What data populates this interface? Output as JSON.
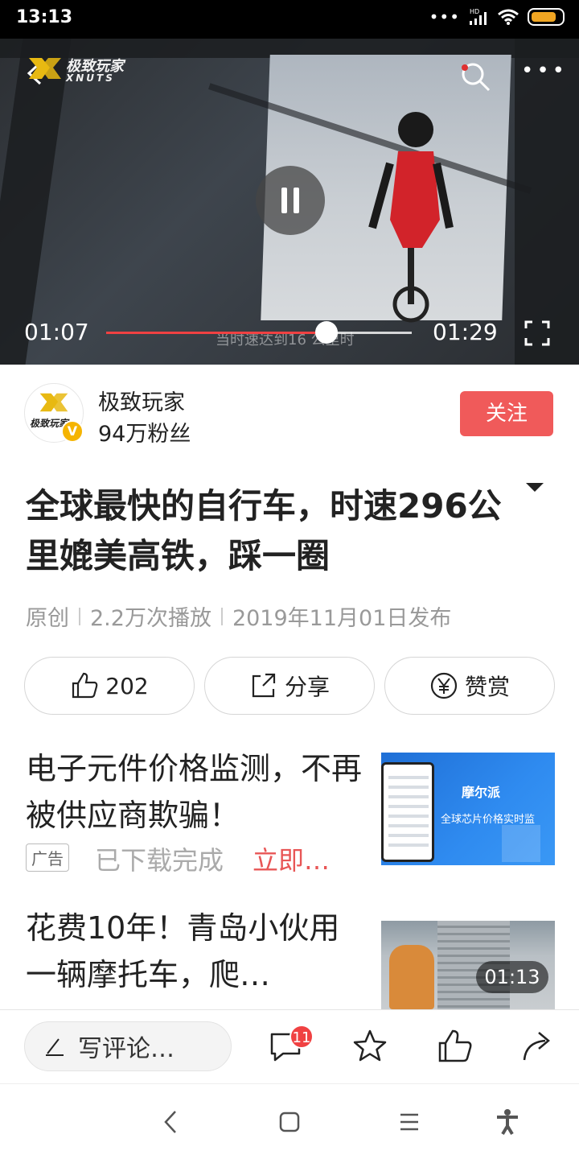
{
  "status_bar": {
    "time": "13:13",
    "network": "HD"
  },
  "video": {
    "brand_name": "极致玩家",
    "brand_sub": "XNUTS",
    "current_time": "01:07",
    "duration": "01:29",
    "progress": 0.72,
    "subtitle": "当时速达到16 公里时"
  },
  "author": {
    "avatar_text": "极致玩家",
    "name": "极致玩家",
    "fans": "94万粉丝",
    "follow_label": "关注",
    "verified_badge": "V"
  },
  "article": {
    "title": "全球最快的自行车，时速296公里媲美高铁，踩一圈",
    "meta": [
      "原创",
      "2.2万次播放",
      "2019年11月01日发布"
    ]
  },
  "actions": {
    "like_count": "202",
    "share_label": "分享",
    "reward_label": "赞赏"
  },
  "feed": [
    {
      "title": "电子元件价格监测，不再被供应商欺骗！",
      "ad_tag": "广告",
      "status": "已下载完成",
      "cta": "立即…",
      "thumb_brand": "摩尔派",
      "thumb_slogan": "全球芯片价格实时监"
    },
    {
      "title": "花费10年！青岛小伙用一辆摩托车，爬…",
      "duration": "01:13"
    }
  ],
  "bottom_bar": {
    "comment_placeholder": "写评论…",
    "comment_count": "11"
  },
  "colors": {
    "accent": "#f04142",
    "follow": "#f05a5a",
    "verified": "#f5b400"
  }
}
